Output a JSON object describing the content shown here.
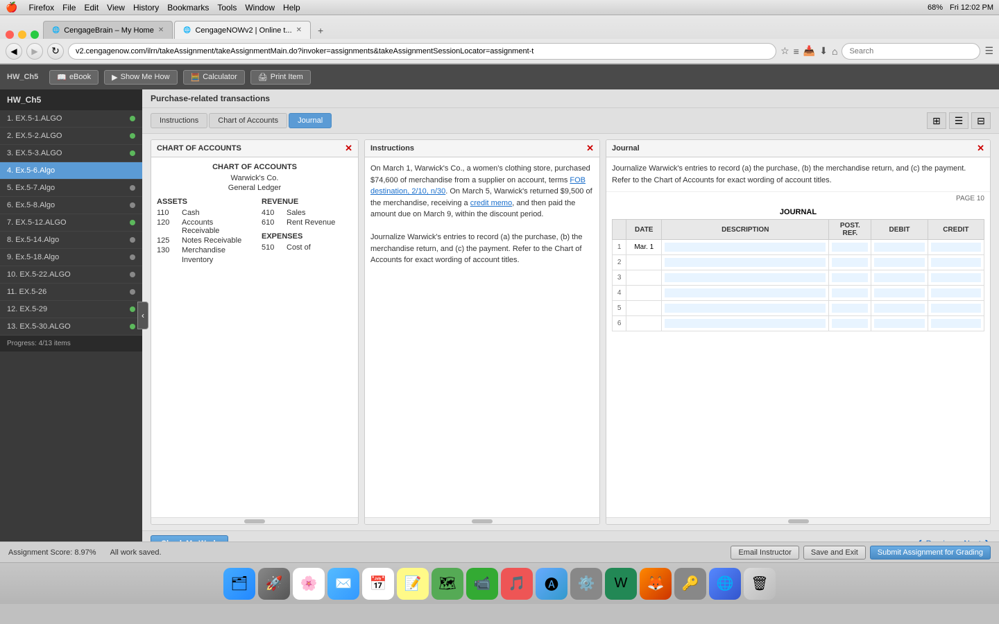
{
  "macmenubar": {
    "apple": "🍎",
    "items": [
      "Firefox",
      "File",
      "Edit",
      "View",
      "History",
      "Bookmarks",
      "Tools",
      "Window",
      "Help"
    ],
    "right_time": "Fri 12:02 PM",
    "right_battery": "68%"
  },
  "browser": {
    "tabs": [
      {
        "label": "CengageBrain – My Home",
        "active": false
      },
      {
        "label": "CengageNOWv2 | Online t...",
        "active": true
      }
    ],
    "url": "v2.cengagenow.com/ilrn/takeAssignment/takeAssignmentMain.do?invoker=assignments&takeAssignmentSessionLocator=assignment-t",
    "search_placeholder": "Search"
  },
  "toolbar": {
    "ebook": "eBook",
    "show_me_how": "Show Me How",
    "calculator": "Calculator",
    "print_item": "Print Item"
  },
  "sidebar": {
    "title": "HW_Ch5",
    "items": [
      {
        "label": "1. EX.5-1.ALGO",
        "dot": "green"
      },
      {
        "label": "2. EX.5-2.ALGO",
        "dot": "green"
      },
      {
        "label": "3. EX.5-3.ALGO",
        "dot": "green"
      },
      {
        "label": "4. Ex.5-6.Algo",
        "dot": "blue",
        "active": true
      },
      {
        "label": "5. Ex.5-7.Algo",
        "dot": "gray"
      },
      {
        "label": "6. Ex.5-8.Algo",
        "dot": "gray"
      },
      {
        "label": "7. EX.5-12.ALGO",
        "dot": "green"
      },
      {
        "label": "8. Ex.5-14.Algo",
        "dot": "gray"
      },
      {
        "label": "9. Ex.5-18.Algo",
        "dot": "gray"
      },
      {
        "label": "10. EX.5-22.ALGO",
        "dot": "gray"
      },
      {
        "label": "11. EX.5-26",
        "dot": "gray"
      },
      {
        "label": "12. EX.5-29",
        "dot": "green"
      },
      {
        "label": "13. EX.5-30.ALGO",
        "dot": "green"
      }
    ],
    "progress": "Progress: 4/13 items"
  },
  "section": {
    "title": "Purchase-related transactions",
    "tabs": [
      "Instructions",
      "Chart of Accounts",
      "Journal"
    ],
    "active_tab": "Journal"
  },
  "chart_of_accounts": {
    "title": "CHART OF ACCOUNTS",
    "subtitle": "Warwick's Co.",
    "sub2": "General Ledger",
    "assets_header": "ASSETS",
    "revenue_header": "REVENUE",
    "expenses_header": "EXPENSES",
    "assets": [
      {
        "num": "110",
        "name": "Cash"
      },
      {
        "num": "120",
        "name": "Accounts Receivable"
      },
      {
        "num": "125",
        "name": "Notes Receivable"
      },
      {
        "num": "130",
        "name": "Merchandise"
      },
      {
        "num": "",
        "name": "Inventory"
      }
    ],
    "revenue": [
      {
        "num": "410",
        "name": "Sales"
      },
      {
        "num": "610",
        "name": "Rent Revenue"
      }
    ],
    "expenses": [
      {
        "num": "510",
        "name": "Cost of"
      }
    ]
  },
  "instructions": {
    "text1": "On March 1, Warwick's Co., a women's clothing store, purchased $74,600 of merchandise from a supplier on account, terms ",
    "link1": "FOB destination, 2/10, n/30",
    "text2": ". On March 5, Warwick's returned $9,500 of the merchandise, receiving a ",
    "link2": "credit memo",
    "text3": ", and then paid the amount due on March 9, within the discount period.",
    "text4": "Journalize Warwick's entries to record (a) the purchase, (b) the merchandise return, and (c) the payment. Refer to the Chart of Accounts for exact wording of account titles."
  },
  "journal": {
    "header": "Journal",
    "instructions": "Journalize Warwick's entries to record (a) the purchase, (b) the merchandise return, and (c) the payment. Refer to the Chart of Accounts for exact wording of account titles.",
    "page_label": "PAGE 10",
    "table_title": "JOURNAL",
    "columns": [
      "DATE",
      "DESCRIPTION",
      "POST. REF.",
      "DEBIT",
      "CREDIT"
    ],
    "rows": [
      {
        "num": "1",
        "date": "Mar. 1",
        "desc": "",
        "post": "",
        "debit": "",
        "credit": ""
      },
      {
        "num": "2",
        "date": "",
        "desc": "",
        "post": "",
        "debit": "",
        "credit": ""
      },
      {
        "num": "3",
        "date": "",
        "desc": "",
        "post": "",
        "debit": "",
        "credit": ""
      },
      {
        "num": "4",
        "date": "",
        "desc": "",
        "post": "",
        "debit": "",
        "credit": ""
      },
      {
        "num": "5",
        "date": "",
        "desc": "",
        "post": "",
        "debit": "",
        "credit": ""
      },
      {
        "num": "6",
        "date": "",
        "desc": "",
        "post": "",
        "debit": "",
        "credit": ""
      }
    ]
  },
  "bottom": {
    "check_work": "Check My Work",
    "previous": "Previous",
    "next": "Next"
  },
  "statusbar": {
    "score": "Assignment Score: 8.97%",
    "work_saved": "All work saved.",
    "email_instructor": "Email Instructor",
    "save_exit": "Save and Exit",
    "submit": "Submit Assignment for Grading"
  }
}
